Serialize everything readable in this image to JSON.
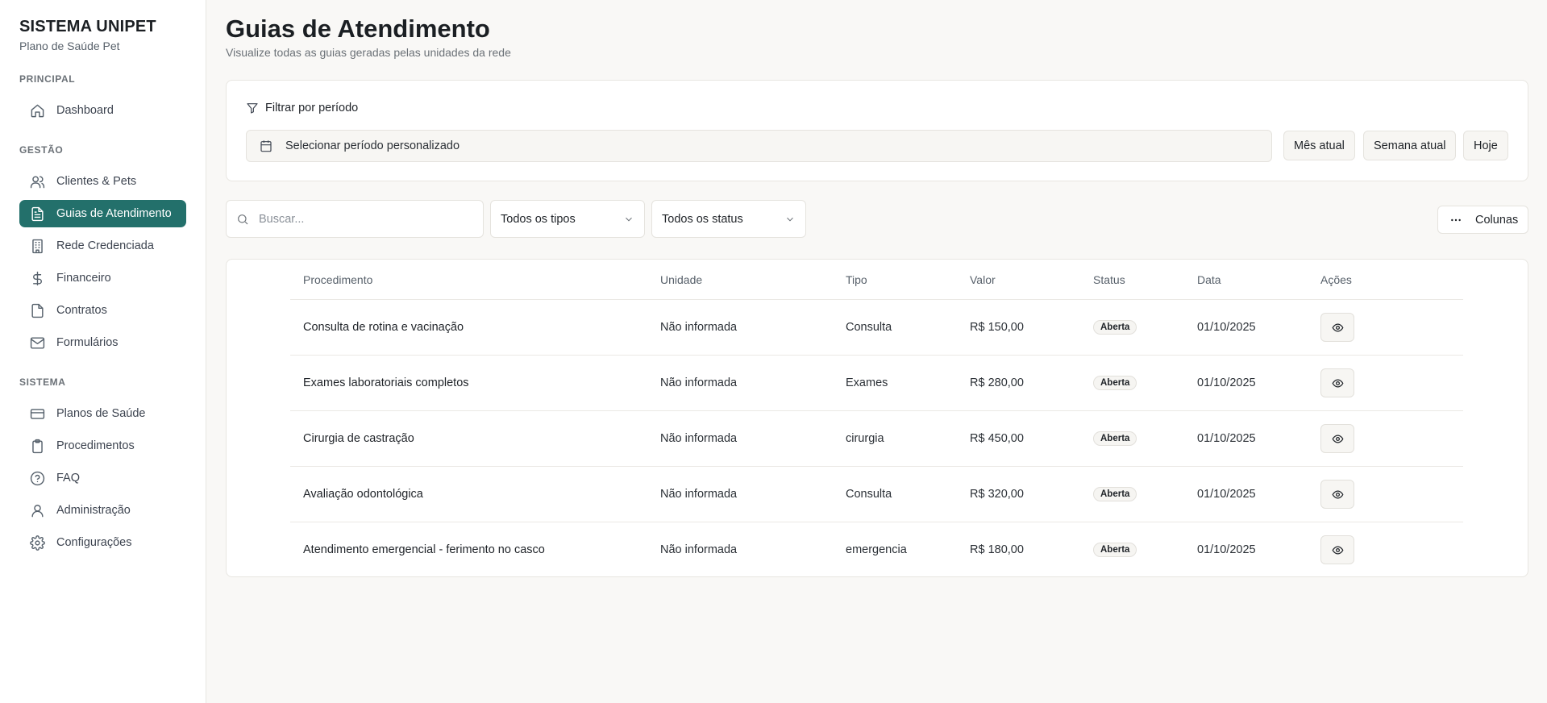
{
  "brand": {
    "title": "SISTEMA UNIPET",
    "subtitle": "Plano de Saúde Pet"
  },
  "sidebar": {
    "sections": [
      {
        "label": "PRINCIPAL"
      },
      {
        "label": "GESTÃO"
      },
      {
        "label": "SISTEMA"
      }
    ],
    "items": [
      {
        "label": "Dashboard",
        "icon": "home-icon"
      },
      {
        "label": "Clientes & Pets",
        "icon": "users-icon"
      },
      {
        "label": "Guias de Atendimento",
        "icon": "file-text-icon",
        "active": true
      },
      {
        "label": "Rede Credenciada",
        "icon": "building-icon"
      },
      {
        "label": "Financeiro",
        "icon": "dollar-icon"
      },
      {
        "label": "Contratos",
        "icon": "file-icon"
      },
      {
        "label": "Formulários",
        "icon": "mail-icon"
      },
      {
        "label": "Planos de Saúde",
        "icon": "credit-card-icon"
      },
      {
        "label": "Procedimentos",
        "icon": "clipboard-icon"
      },
      {
        "label": "FAQ",
        "icon": "help-circle-icon"
      },
      {
        "label": "Administração",
        "icon": "user-icon"
      },
      {
        "label": "Configurações",
        "icon": "gear-icon"
      }
    ]
  },
  "header": {
    "title": "Guias de Atendimento",
    "subtitle": "Visualize todas as guias geradas pelas unidades da rede"
  },
  "filter": {
    "heading": "Filtrar por período",
    "period_placeholder": "Selecionar período personalizado",
    "quick": [
      "Mês atual",
      "Semana atual",
      "Hoje"
    ]
  },
  "toolbar": {
    "search_placeholder": "Buscar...",
    "type_select": "Todos os tipos",
    "status_select": "Todos os status",
    "columns_label": "Colunas"
  },
  "table": {
    "columns": [
      "Procedimento",
      "Unidade",
      "Tipo",
      "Valor",
      "Status",
      "Data",
      "Ações"
    ],
    "rows": [
      {
        "procedimento": "Consulta de rotina e vacinação",
        "unidade": "Não informada",
        "tipo": "Consulta",
        "valor": "R$ 150,00",
        "status": "Aberta",
        "data": "01/10/2025"
      },
      {
        "procedimento": "Exames laboratoriais completos",
        "unidade": "Não informada",
        "tipo": "Exames",
        "valor": "R$ 280,00",
        "status": "Aberta",
        "data": "01/10/2025"
      },
      {
        "procedimento": "Cirurgia de castração",
        "unidade": "Não informada",
        "tipo": "cirurgia",
        "valor": "R$ 450,00",
        "status": "Aberta",
        "data": "01/10/2025"
      },
      {
        "procedimento": "Avaliação odontológica",
        "unidade": "Não informada",
        "tipo": "Consulta",
        "valor": "R$ 320,00",
        "status": "Aberta",
        "data": "01/10/2025"
      },
      {
        "procedimento": "Atendimento emergencial - ferimento no casco",
        "unidade": "Não informada",
        "tipo": "emergencia",
        "valor": "R$ 180,00",
        "status": "Aberta",
        "data": "01/10/2025"
      }
    ]
  },
  "colors": {
    "accent": "#23706b",
    "background": "#f9f8f6",
    "border": "#e8e6e1"
  }
}
